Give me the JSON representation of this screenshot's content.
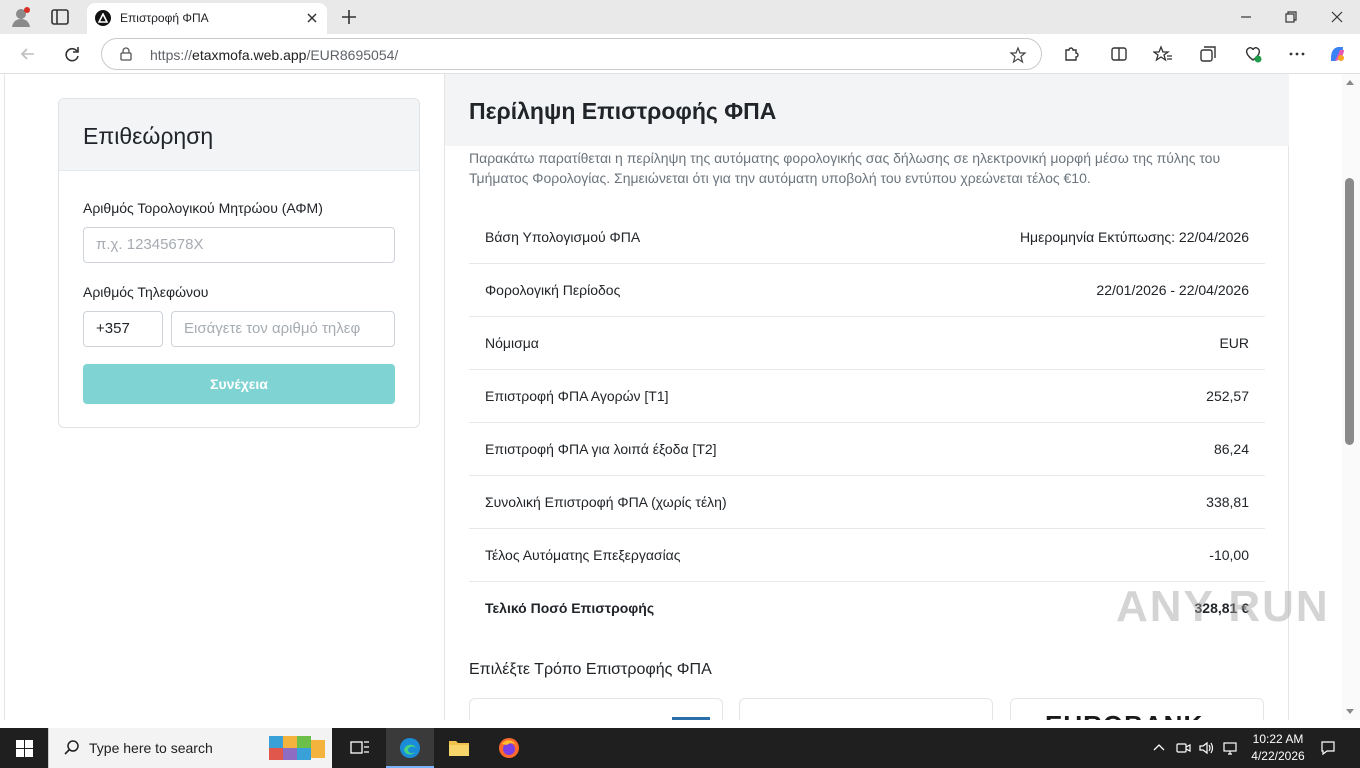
{
  "browser": {
    "tab_title": "Επιστροφή ΦΠΑ",
    "url_prefix": "https://",
    "url_host": "etaxmofa.web.app",
    "url_path": "/EUR8695054/"
  },
  "left_card": {
    "title": "Επιθεώρηση",
    "tin_label": "Αριθμός Τορολογικού Μητρώου (ΑΦΜ)",
    "tin_placeholder": "π.χ. 12345678X",
    "phone_label": "Αριθμός Τηλεφώνου",
    "country_code": "+357",
    "phone_placeholder": "Εισάγετε τον αριθμό τηλεφ",
    "submit_label": "Συνέχεια"
  },
  "summary": {
    "title": "Περίληψη Επιστροφής ΦΠΑ",
    "intro": "Παρακάτω παρατίθεται η περίληψη της αυτόματης φορολογικής σας δήλωσης σε ηλεκτρονική μορφή μέσω της πύλης του Τμήματος Φορολογίας. Σημειώνεται ότι για την αυτόματη υποβολή του εντύπου χρεώνεται τέλος €10.",
    "rows": [
      {
        "label": "Βάση Υπολογισμού ΦΠΑ",
        "value": "Ημερομηνία Εκτύπωσης: 22/04/2026"
      },
      {
        "label": "Φορολογική Περίοδος",
        "value": "22/01/2026 - 22/04/2026"
      },
      {
        "label": "Νόμισμα",
        "value": "EUR"
      },
      {
        "label": "Επιστροφή ΦΠΑ Αγορών [Τ1]",
        "value": "252,57"
      },
      {
        "label": "Επιστροφή ΦΠΑ για λοιπά έξοδα [Τ2]",
        "value": "86,24"
      },
      {
        "label": "Συνολική Επιστροφή ΦΠΑ (χωρίς τέλη)",
        "value": "338,81"
      },
      {
        "label": "Τέλος Αυτόματης Επεξεργασίας",
        "value": "-10,00"
      },
      {
        "label": "Τελικό Ποσό Επιστροφής",
        "value": "328,81 €"
      }
    ],
    "method_title": "Επιλέξτε Τρόπο Επιστροφής ΦΠΑ",
    "bank_logo_text": "EUROBANK"
  },
  "watermark": "ANY RUN",
  "taskbar": {
    "search_text": "Type here to search",
    "time": "10:22 AM",
    "date": "4/22/2026"
  },
  "colors": {
    "accent": "#7fd3d3",
    "header_bg": "#f3f4f5",
    "taskbar_bg": "#1f1f1f"
  }
}
